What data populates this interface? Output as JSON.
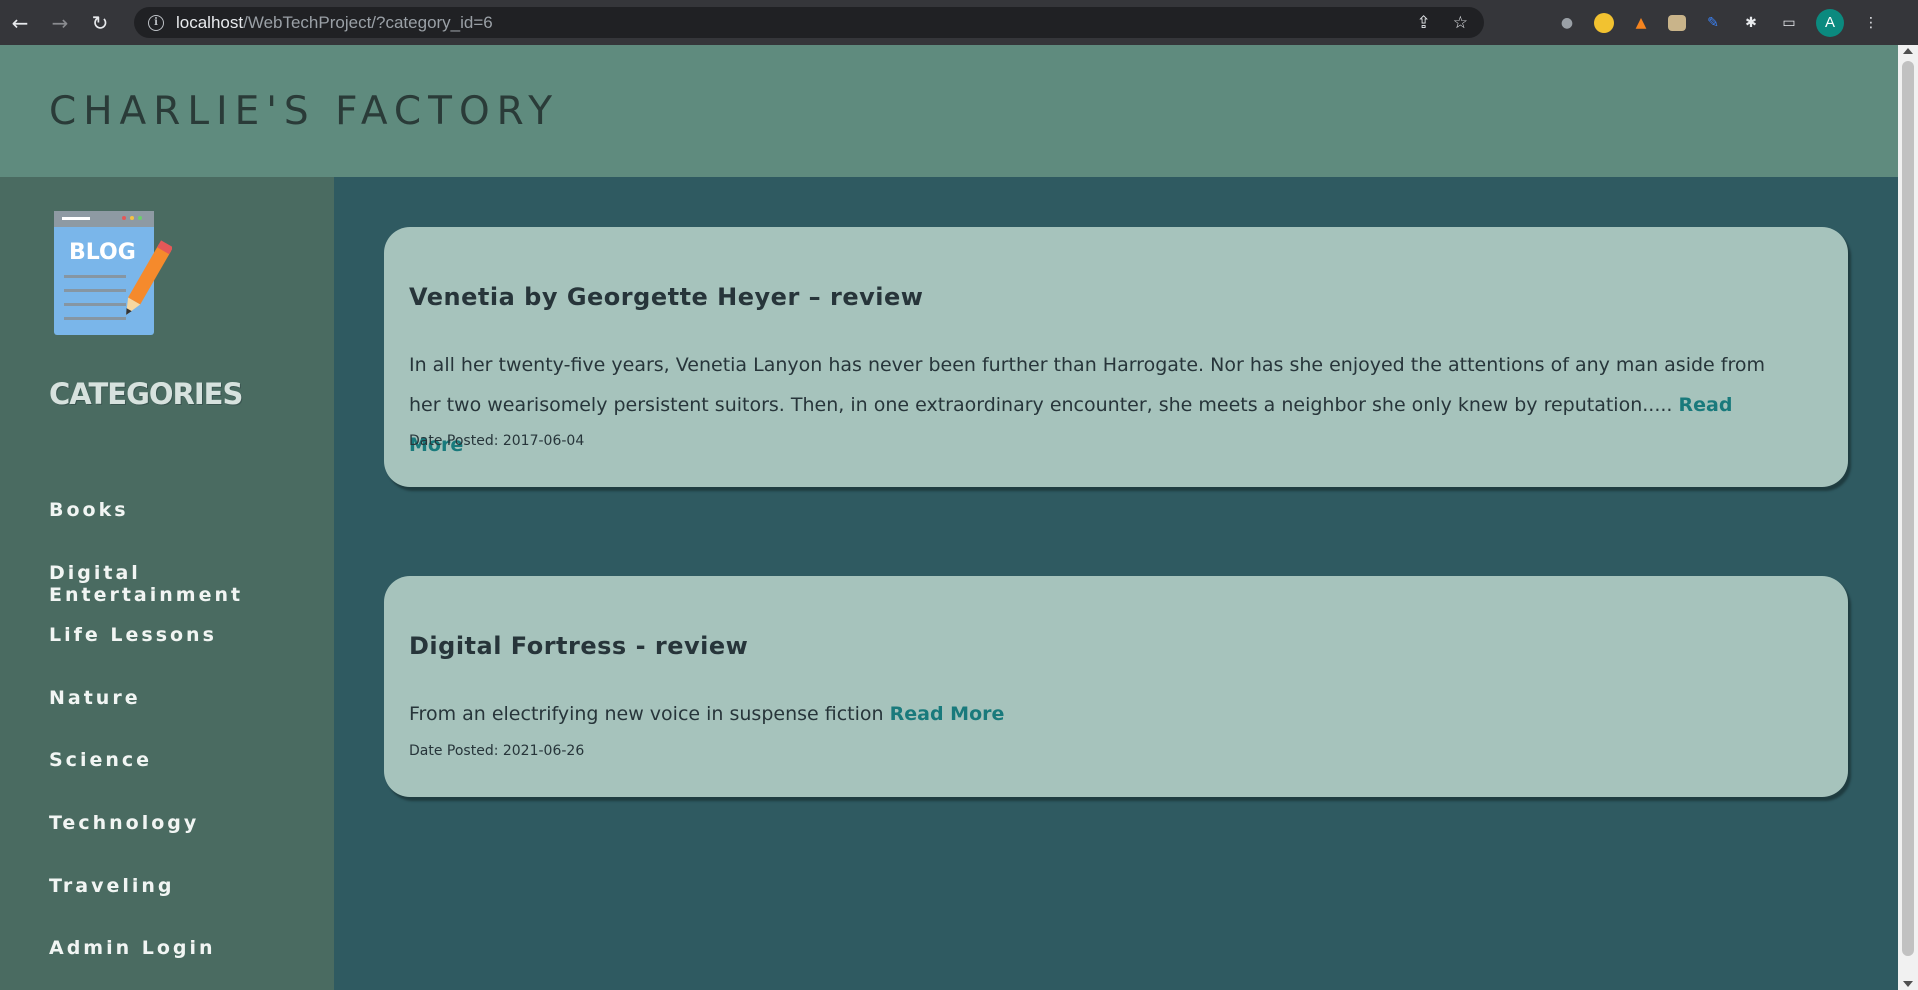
{
  "browser": {
    "url_host": "localhost",
    "url_path": "/WebTechProject/?category_id=6",
    "profile_initial": "A"
  },
  "site": {
    "title": "CHARLIE'S FACTORY"
  },
  "sidebar": {
    "heading": "CATEGORIES",
    "items": [
      {
        "label": "Books"
      },
      {
        "label": "Digital Entertainment"
      },
      {
        "label": "Life Lessons"
      },
      {
        "label": "Nature"
      },
      {
        "label": "Science"
      },
      {
        "label": "Technology"
      },
      {
        "label": "Traveling"
      },
      {
        "label": "Admin Login"
      }
    ]
  },
  "posts": [
    {
      "title": "Venetia by Georgette Heyer – review",
      "excerpt": "In all her twenty-five years, Venetia Lanyon has never been further than Harrogate. Nor has she enjoyed the attentions of any man aside from her two wearisomely persistent suitors. Then, in one extraordinary encounter, she meets a neighbor she only knew by reputation.....",
      "read_more": "Read More",
      "date": "Date Posted: 2017-06-04"
    },
    {
      "title": "Digital Fortress - review",
      "excerpt": "From an electrifying new voice in suspense fiction",
      "read_more": "Read More",
      "date": "Date Posted: 2021-06-26"
    }
  ],
  "colors": {
    "header_bg": "#5f8b7e",
    "sidebar_bg": "#4a6b61",
    "content_bg": "#2f5a61",
    "card_bg": "#a6c3bc",
    "link": "#197a7c"
  }
}
